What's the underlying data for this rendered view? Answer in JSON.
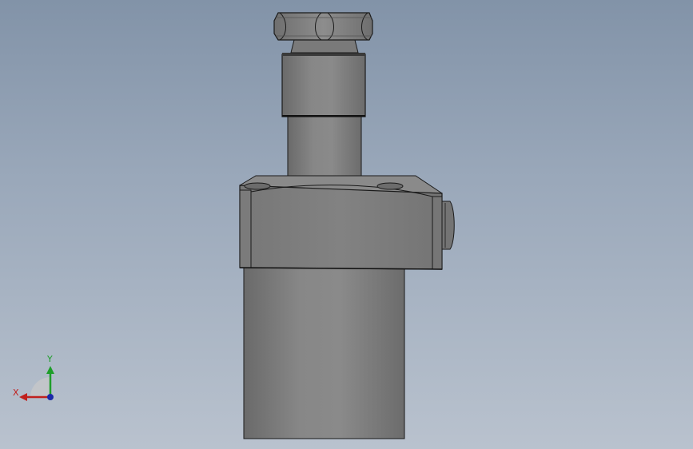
{
  "viewport": {
    "background_top": "#8293a8",
    "background_bottom": "#b9c2ce"
  },
  "model": {
    "body_color": "#808080",
    "edge_color": "#1a1a1a",
    "parts": [
      "hex-nut",
      "upper-sleeve",
      "stem",
      "clamp-block",
      "side-port",
      "lower-cylinder"
    ]
  },
  "triad": {
    "x_label": "X",
    "y_label": "Y",
    "x_color": "#c0201e",
    "y_color": "#1e9e2a",
    "z_color": "#1a2aa8"
  }
}
